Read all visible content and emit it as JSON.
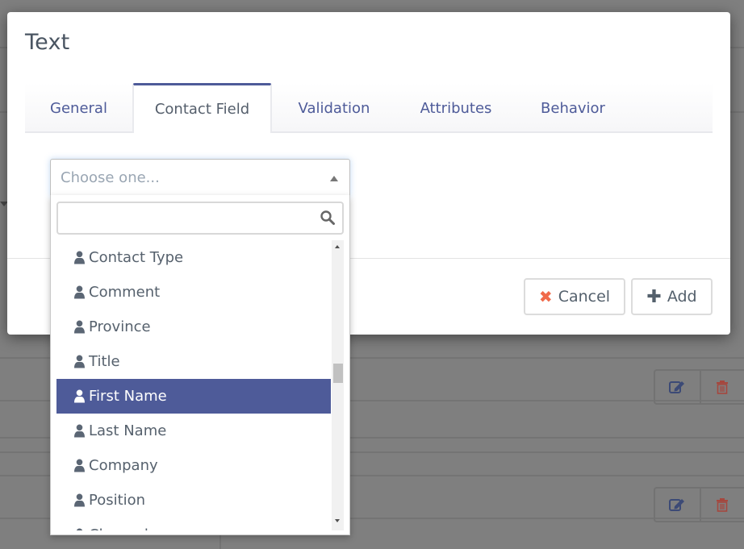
{
  "modal": {
    "title": "Text",
    "tabs": [
      {
        "label": "General",
        "active": false
      },
      {
        "label": "Contact Field",
        "active": true
      },
      {
        "label": "Validation",
        "active": false
      },
      {
        "label": "Attributes",
        "active": false
      },
      {
        "label": "Behavior",
        "active": false
      }
    ],
    "select": {
      "placeholder": "Choose one...",
      "search_value": "",
      "options": [
        {
          "label": "Contact Type",
          "icon": "user-icon",
          "selected": false
        },
        {
          "label": "Comment",
          "icon": "user-icon",
          "selected": false
        },
        {
          "label": "Province",
          "icon": "user-icon",
          "selected": false
        },
        {
          "label": "Title",
          "icon": "user-icon",
          "selected": false
        },
        {
          "label": "First Name",
          "icon": "user-icon",
          "selected": true
        },
        {
          "label": "Last Name",
          "icon": "user-icon",
          "selected": false
        },
        {
          "label": "Company",
          "icon": "user-icon",
          "selected": false
        },
        {
          "label": "Position",
          "icon": "user-icon",
          "selected": false
        },
        {
          "label": "Channel",
          "icon": "user-icon",
          "selected": false
        }
      ],
      "scroll_position": 0.45
    },
    "buttons": {
      "cancel": {
        "label": "Cancel",
        "icon": "times-icon"
      },
      "add": {
        "label": "Add",
        "icon": "plus-icon"
      }
    }
  },
  "background": {
    "row_actions": [
      {
        "edit_icon": "edit-icon",
        "delete_icon": "trash-icon"
      },
      {
        "edit_icon": "edit-icon",
        "delete_icon": "trash-icon"
      }
    ]
  },
  "colors": {
    "accent": "#4e5b99",
    "cancel_icon": "#f06a4a",
    "text": "#56616d",
    "overlay": "#7f7f7f"
  }
}
